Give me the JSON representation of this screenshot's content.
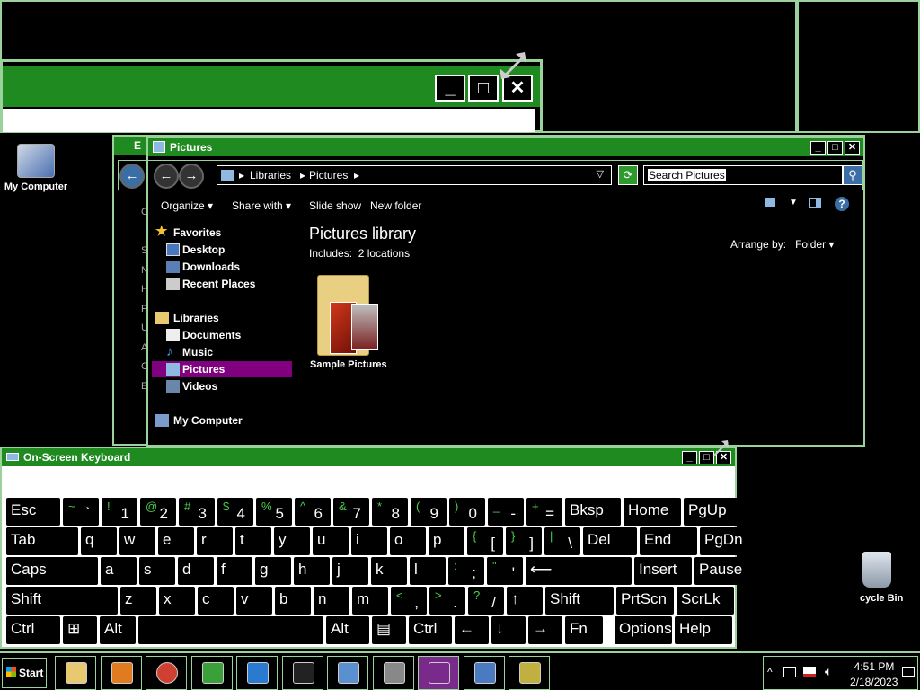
{
  "desktop": {
    "icons": [
      {
        "label": "My Computer"
      },
      {
        "label": "cycle Bin"
      }
    ]
  },
  "explorer": {
    "title": "Pictures",
    "behind_title": "E",
    "address": {
      "root": "Libraries",
      "current": "Pictures"
    },
    "search_placeholder": "Search Pictures",
    "commands": [
      "Organize",
      "Share with",
      "Slide show",
      "New folder"
    ],
    "library_title": "Pictures library",
    "includes": "Includes:",
    "locations": "2 locations",
    "arrange_label": "Arrange by:",
    "arrange_value": "Folder",
    "nav": {
      "favorites": "Favorites",
      "desktop": "Desktop",
      "downloads": "Downloads",
      "recent": "Recent Places",
      "libraries": "Libraries",
      "documents": "Documents",
      "music": "Music",
      "pictures": "Pictures",
      "videos": "Videos",
      "computer": "My Computer"
    },
    "folder_label": "Sample Pictures",
    "behind_letters": [
      "C",
      "S",
      "N",
      "H",
      "P",
      "U",
      "A",
      "C",
      "E"
    ]
  },
  "osk": {
    "title": "On-Screen Keyboard",
    "rows": [
      [
        {
          "l": "Esc"
        },
        {
          "s": "~",
          "m": "`"
        },
        {
          "s": "!",
          "m": "1"
        },
        {
          "s": "@",
          "m": "2"
        },
        {
          "s": "#",
          "m": "3"
        },
        {
          "s": "$",
          "m": "4"
        },
        {
          "s": "%",
          "m": "5"
        },
        {
          "s": "^",
          "m": "6"
        },
        {
          "s": "&",
          "m": "7"
        },
        {
          "s": "*",
          "m": "8"
        },
        {
          "s": "(",
          "m": "9"
        },
        {
          "s": ")",
          "m": "0"
        },
        {
          "s": "_",
          "m": "-"
        },
        {
          "s": "+",
          "m": "="
        },
        {
          "l": "Bksp"
        },
        {
          "l": "Home"
        },
        {
          "l": "PgUp"
        }
      ],
      [
        {
          "l": "Tab"
        },
        {
          "l": "q"
        },
        {
          "l": "w"
        },
        {
          "l": "e"
        },
        {
          "l": "r"
        },
        {
          "l": "t"
        },
        {
          "l": "y"
        },
        {
          "l": "u"
        },
        {
          "l": "i"
        },
        {
          "l": "o"
        },
        {
          "l": "p"
        },
        {
          "s": "{",
          "m": "["
        },
        {
          "s": "}",
          "m": "]"
        },
        {
          "s": "|",
          "m": "\\"
        },
        {
          "l": "Del"
        },
        {
          "l": "End"
        },
        {
          "l": "PgDn"
        }
      ],
      [
        {
          "l": "Caps"
        },
        {
          "l": "a"
        },
        {
          "l": "s"
        },
        {
          "l": "d"
        },
        {
          "l": "f"
        },
        {
          "l": "g"
        },
        {
          "l": "h"
        },
        {
          "l": "j"
        },
        {
          "l": "k"
        },
        {
          "l": "l"
        },
        {
          "s": ":",
          "m": ";"
        },
        {
          "s": "\"",
          "m": "'"
        },
        {
          "l": "⟵"
        },
        {
          "l": "Insert"
        },
        {
          "l": "Pause"
        }
      ],
      [
        {
          "l": "Shift"
        },
        {
          "l": "z"
        },
        {
          "l": "x"
        },
        {
          "l": "c"
        },
        {
          "l": "v"
        },
        {
          "l": "b"
        },
        {
          "l": "n"
        },
        {
          "l": "m"
        },
        {
          "s": "<",
          "m": ","
        },
        {
          "s": ">",
          "m": "."
        },
        {
          "s": "?",
          "m": "/"
        },
        {
          "l": "↑"
        },
        {
          "l": "Shift"
        },
        {
          "l": "PrtScn"
        },
        {
          "l": "ScrLk"
        }
      ],
      [
        {
          "l": "Ctrl"
        },
        {
          "l": "⊞"
        },
        {
          "l": "Alt"
        },
        {
          "l": ""
        },
        {
          "l": "Alt"
        },
        {
          "l": "▤"
        },
        {
          "l": "Ctrl"
        },
        {
          "l": "←"
        },
        {
          "l": "↓"
        },
        {
          "l": "→"
        },
        {
          "l": "Fn"
        },
        {
          "l": "Options"
        },
        {
          "l": "Help"
        }
      ]
    ]
  },
  "taskbar": {
    "start": "Start",
    "time": "4:51 PM",
    "date": "2/18/2023",
    "apps": [
      "file-explorer",
      "media-player",
      "chrome",
      "csharp",
      "internet-explorer",
      "command-prompt",
      "control-panel",
      "microphone",
      "remote-desktop",
      "network",
      "help-balloon"
    ]
  },
  "colors": {
    "accent": "#1f8a1f",
    "border": "#9bd19b",
    "selected": "#800080",
    "key_shift": "#4ad04a"
  }
}
